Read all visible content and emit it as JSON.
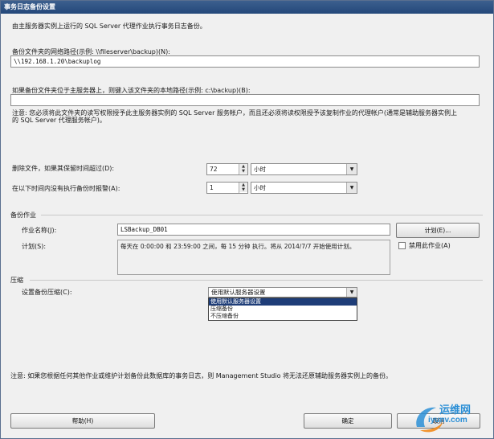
{
  "window": {
    "title": "事务日志备份设置"
  },
  "intro": "由主服务器实例上运行的 SQL Server 代理作业执行事务日志备份。",
  "network_path": {
    "label": "备份文件夹的网络路径(示例: \\\\fileserver\\backup)(N):",
    "value": "\\\\192.168.1.20\\backuplog"
  },
  "local_path": {
    "label": "如果备份文件夹位于主服务器上，则键入该文件夹的本地路径(示例: c:\\backup)(B):",
    "value": ""
  },
  "permission_note": {
    "line1": "注意: 您必须将此文件夹的读写权限授予此主服务器实例的 SQL Server 服务帐户，而且还必须将读权限授予该复制作业的代理帐户(通常是辅助服务器实例上",
    "line2": "的 SQL Server 代理服务帐户)。"
  },
  "delete_files": {
    "label": "删除文件，如果其保留时间超过(D):",
    "value": "72",
    "unit": "小时"
  },
  "alert": {
    "label": "在以下时间内没有执行备份时报警(A):",
    "value": "1",
    "unit": "小时"
  },
  "backup_job": {
    "section_label": "备份作业",
    "job_name_label": "作业名称(J):",
    "job_name_value": "LSBackup_DB01",
    "schedule_button": "计划(E)...",
    "schedule_label": "计划(S):",
    "schedule_text": "每天在 0:00:00 和 23:59:00 之间，每 15 分钟 执行。将从 2014/7/7 开始使用计划。",
    "disable_job_label": "禁用此作业(A)"
  },
  "compression": {
    "section_label": "压缩",
    "label": "设置备份压缩(C):",
    "selected": "使用默认服务器设置",
    "options": [
      "使用默认服务器设置",
      "压缩备份",
      "不压缩备份"
    ]
  },
  "footer_note": "注意: 如果您根据任何其他作业或维护计划备份此数据库的事务日志，则 Management Studio 将无法还原辅助服务器实例上的备份。",
  "buttons": {
    "help": "帮助(H)",
    "ok": "确定",
    "cancel": "取消"
  },
  "watermark": {
    "text_cn": "运维网",
    "text_en": "iyunv.com"
  }
}
